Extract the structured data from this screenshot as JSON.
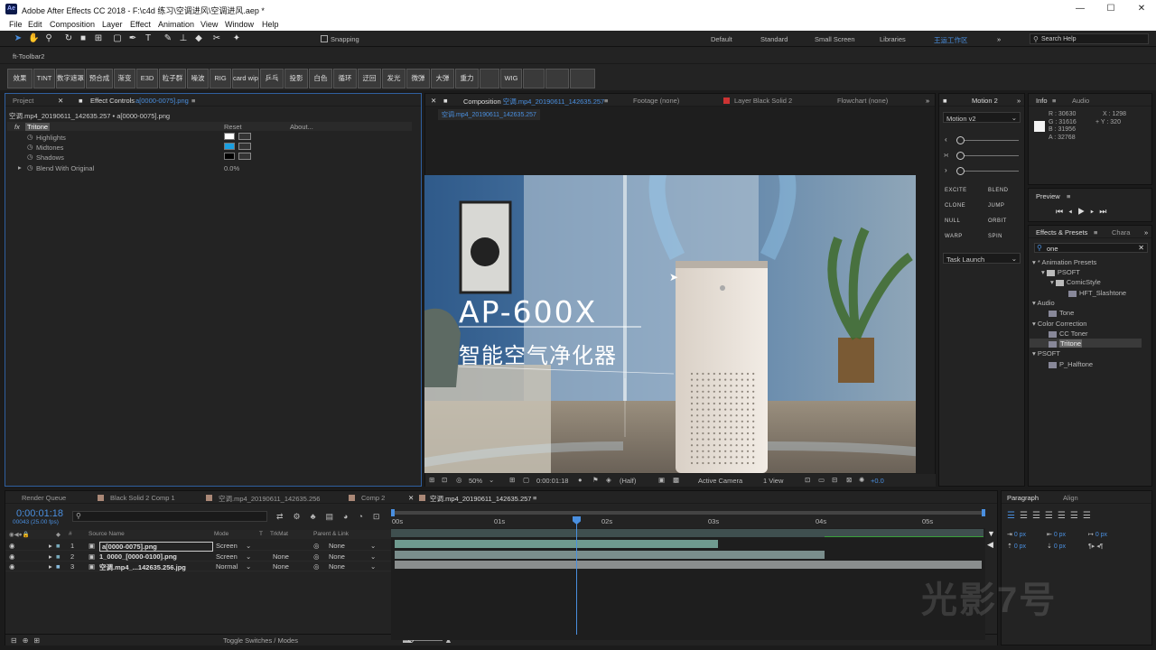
{
  "window": {
    "title": "Adobe After Effects CC 2018 - F:\\c4d 练习\\空调进风\\空调进风.aep *",
    "app_icon": "Ae"
  },
  "menu": [
    "File",
    "Edit",
    "Composition",
    "Layer",
    "Effect",
    "Animation",
    "View",
    "Window",
    "Help"
  ],
  "toolbar": {
    "snapping": "Snapping",
    "workspaces": [
      "Default",
      "Standard",
      "Small Screen",
      "Libraries"
    ],
    "active_workspace": "王运工作区",
    "search_placeholder": "Search Help"
  },
  "ft_toolbar": {
    "label": "ft-Toolbar2",
    "buttons": [
      "效果",
      "TINT",
      "数字遮罩",
      "预合成",
      "渐变",
      "E3D",
      "粒子群",
      "噪波",
      "RIG",
      "card wipe",
      "乒乓",
      "投影",
      "白色",
      "循环",
      "迂回",
      "发光",
      "微弹",
      "大弹",
      "重力",
      "",
      "WIG",
      "",
      "",
      ""
    ]
  },
  "left_panel": {
    "tabs": [
      "Project",
      "Effect Controls"
    ],
    "effect_target": "a[0000-0075].png",
    "layer_path": "空调.mp4_20190611_142635.257 • a[0000-0075].png",
    "effect_name": "Tritone",
    "reset": "Reset",
    "about": "About...",
    "props": [
      "Highlights",
      "Midtones",
      "Shadows",
      "Blend With Original"
    ],
    "blend_value": "0.0",
    "blend_unit": "%",
    "colors": {
      "highlights": "#ffffff",
      "midtones": "#1a9fe0",
      "shadows": "#000000"
    }
  },
  "viewer": {
    "comp_tab_prefix": "Composition",
    "comp_name": "空调.mp4_20190611_142635.257",
    "footage_tab": "Footage (none)",
    "layer_tab": "Layer Black Solid 2",
    "flowchart_tab": "Flowchart (none)",
    "breadcrumb": "空调.mp4_20190611_142635.257",
    "overlay_title": "AP-600X",
    "overlay_subtitle": "智能空气净化器",
    "zoom": "50%",
    "timecode": "0:00:01:18",
    "resolution": "(Half)",
    "camera": "Active Camera",
    "views": "1 View",
    "exposure": "+0.0"
  },
  "motion_panel": {
    "tab": "Motion 2",
    "dropdown": "Motion v2",
    "buttons": [
      "EXCITE",
      "BLEND",
      "CLONE",
      "JUMP",
      "NULL",
      "ORBIT",
      "WARP",
      "SPIN"
    ],
    "task": "Task Launch"
  },
  "info_panel": {
    "tabs": [
      "Info",
      "Audio"
    ],
    "r": "R : 30630",
    "g": "G : 31616",
    "b": "B : 31956",
    "a": "A : 32768",
    "x": "X : 1298",
    "y": "+ Y : 320"
  },
  "preview_panel": {
    "title": "Preview"
  },
  "effects_panel": {
    "tabs": [
      "Effects & Presets",
      "Chara"
    ],
    "search": "one",
    "tree": [
      "* Animation Presets",
      "PSOFT",
      "ComicStyle",
      "HFT_Slashtone",
      "Audio",
      "Tone",
      "Color Correction",
      "CC Toner",
      "Tritone",
      "PSOFT",
      "P_Halftone"
    ]
  },
  "timeline": {
    "tabs": [
      "Render Queue",
      "Black Solid 2 Comp 1",
      "空调.mp4_20190611_142635.256",
      "Comp 2",
      "空调.mp4_20190611_142635.257"
    ],
    "timecode": "0:00:01:18",
    "fps": "00043 (25.00 fps)",
    "search_placeholder": "",
    "columns": [
      "#",
      "Source Name",
      "Mode",
      "T",
      "TrkMat",
      "Parent & Link"
    ],
    "layers": [
      {
        "num": "1",
        "name": "a[0000-0075].png",
        "mode": "Screen",
        "trkmat": "",
        "parent": "None"
      },
      {
        "num": "2",
        "name": "1_0000_[0000-0100].png",
        "mode": "Screen",
        "trkmat": "None",
        "parent": "None"
      },
      {
        "num": "3",
        "name": "空调.mp4_...142635.256.jpg",
        "mode": "Normal",
        "trkmat": "None",
        "parent": "None"
      }
    ],
    "ruler": [
      "00s",
      "01s",
      "02s",
      "03s",
      "04s",
      "05s"
    ],
    "toggle": "Toggle Switches / Modes"
  },
  "paragraph_panel": {
    "tabs": [
      "Paragraph",
      "Align"
    ],
    "values": [
      "0 px",
      "0 px",
      "0 px",
      "0 px",
      "0 px"
    ]
  },
  "watermark": "光影7号"
}
